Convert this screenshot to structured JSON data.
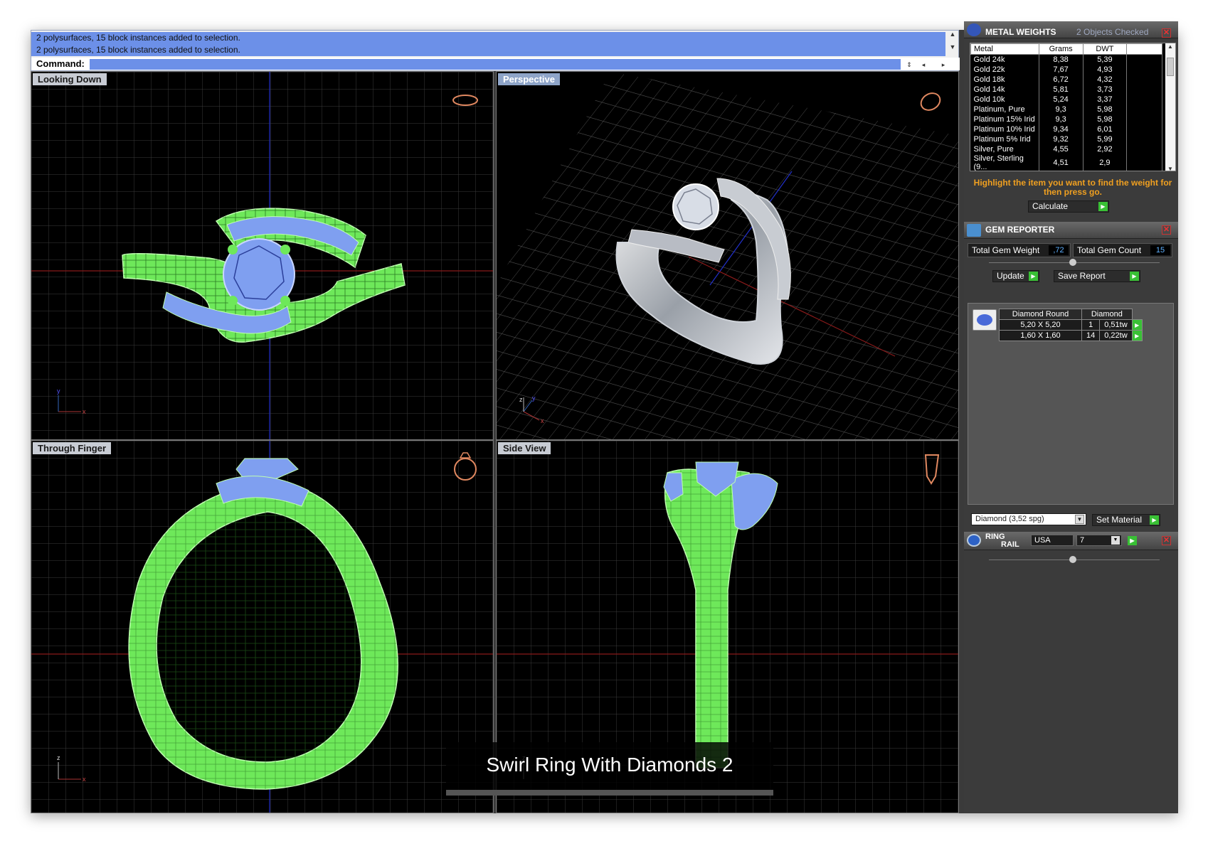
{
  "command": {
    "history": [
      "2 polysurfaces, 15 block instances added to selection.",
      "2 polysurfaces, 15 block instances added to selection."
    ],
    "prompt_label": "Command:",
    "input_value": ""
  },
  "viewports": [
    {
      "label": "Looking Down"
    },
    {
      "label": "Perspective"
    },
    {
      "label": "Through Finger"
    },
    {
      "label": "Side View"
    }
  ],
  "axes": {
    "x": "x",
    "y": "y",
    "z": "z"
  },
  "metal_weights": {
    "title": "METAL WEIGHTS",
    "status": "2 Objects Checked",
    "columns": [
      "Metal",
      "Grams",
      "DWT"
    ],
    "rows": [
      [
        "Gold 24k",
        "8,38",
        "5,39"
      ],
      [
        "Gold 22k",
        "7,67",
        "4,93"
      ],
      [
        "Gold 18k",
        "6,72",
        "4,32"
      ],
      [
        "Gold 14k",
        "5,81",
        "3,73"
      ],
      [
        "Gold 10k",
        "5,24",
        "3,37"
      ],
      [
        "Platinum, Pure",
        "9,3",
        "5,98"
      ],
      [
        "Platinum 15% Irid",
        "9,3",
        "5,98"
      ],
      [
        "Platinum 10% Irid",
        "9,34",
        "6,01"
      ],
      [
        "Platinum 5% Irid",
        "9,32",
        "5,99"
      ],
      [
        "Silver, Pure",
        "4,55",
        "2,92"
      ],
      [
        "Silver, Sterling (9...",
        "4,51",
        "2,9"
      ]
    ],
    "hint": "Highlight the item you want to find the weight for then press go.",
    "calculate_label": "Calculate"
  },
  "gem_reporter": {
    "title": "GEM REPORTER",
    "total_weight_label": "Total Gem Weight",
    "total_weight_value": ",72",
    "total_count_label": "Total Gem Count",
    "total_count_value": "15",
    "update_label": "Update",
    "save_label": "Save Report",
    "columns": [
      "Diamond Round",
      "Diamond"
    ],
    "rows": [
      {
        "size": "5,20 X 5,20",
        "count": "1",
        "weight": "0,51tw"
      },
      {
        "size": "1,60 X 1,60",
        "count": "14",
        "weight": "0,22tw"
      }
    ],
    "material_select": "Diamond    (3,52 spg)",
    "set_material_label": "Set Material"
  },
  "ring_rail": {
    "title_line1": "RING",
    "title_line2": "RAIL",
    "country": "USA",
    "size": "7"
  },
  "caption": "Swirl Ring With Diamonds 2",
  "colors": {
    "accent": "#6c90e8",
    "wire": "#7ef06a",
    "gem": "#7f9ff0",
    "hint": "#f0a020",
    "go": "#39c035"
  }
}
